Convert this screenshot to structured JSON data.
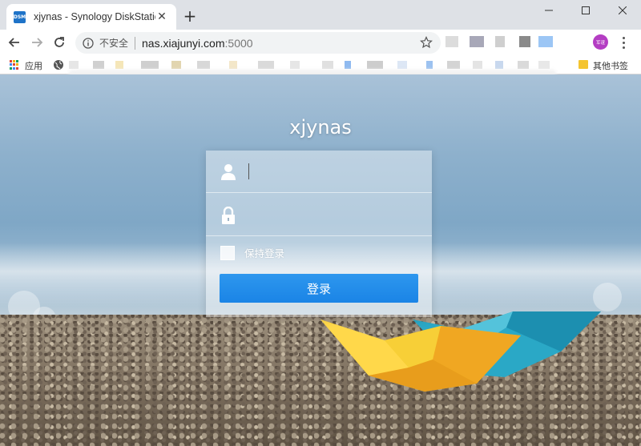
{
  "browser": {
    "tab": {
      "favicon_text": "DSM",
      "title": "xjynas - Synology DiskStation",
      "close_glyph": "✕"
    },
    "new_tab_glyph": "+",
    "window_controls": {
      "minimize": "—",
      "maximize": "☐",
      "close": "✕"
    },
    "address_bar": {
      "security_label": "不安全",
      "host": "nas.xiajunyi.com",
      "port": ":5000"
    },
    "profile_label": "军谊",
    "bookmarks": {
      "apps_label": "应用",
      "other_bookmarks_label": "其他书签"
    },
    "icons": [
      "back-arrow-icon",
      "forward-arrow-icon",
      "reload-icon",
      "info-icon",
      "star-icon",
      "menu-icon",
      "apps-grid-icon",
      "globe-icon",
      "folder-icon"
    ]
  },
  "login": {
    "server_name": "xjynas",
    "username": {
      "value": "",
      "placeholder": ""
    },
    "password": {
      "value": "",
      "placeholder": ""
    },
    "remember_me": {
      "label": "保持登录",
      "checked": false
    },
    "submit_label": "登录"
  },
  "colors": {
    "accent": "#1a84e6",
    "profile": "#b43dc3",
    "boat_yellow": "#f5c320",
    "boat_teal": "#2aa8c6"
  }
}
